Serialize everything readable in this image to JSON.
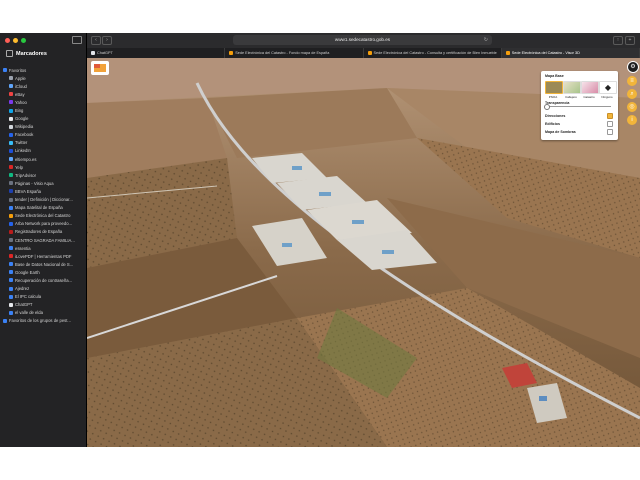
{
  "sidebar": {
    "title": "Marcadores",
    "items": [
      {
        "label": "Favoritos",
        "color": "#3b82f6",
        "type": "folder"
      },
      {
        "label": "Apple",
        "color": "#9ca3af"
      },
      {
        "label": "iCloud",
        "color": "#60a5fa"
      },
      {
        "label": "eBay",
        "color": "#ef4444"
      },
      {
        "label": "Yahoo",
        "color": "#7c3aed"
      },
      {
        "label": "Bing",
        "color": "#0ea5e9"
      },
      {
        "label": "Google",
        "color": "#e5e7eb"
      },
      {
        "label": "Wikipedia",
        "color": "#d1d5db"
      },
      {
        "label": "Facebook",
        "color": "#2563eb"
      },
      {
        "label": "Twitter",
        "color": "#38bdf8"
      },
      {
        "label": "LinkedIn",
        "color": "#1d4ed8"
      },
      {
        "label": "eltiempo.es",
        "color": "#60a5fa"
      },
      {
        "label": "Yelp",
        "color": "#dc2626"
      },
      {
        "label": "TripAdvisor",
        "color": "#10b981"
      },
      {
        "label": "Páginas - Visio Aqua",
        "color": "#6b7280"
      },
      {
        "label": "BBVA España",
        "color": "#1e40af"
      },
      {
        "label": "tender | Definición | Diccionar...",
        "color": "#6b7280"
      },
      {
        "label": "Mapa Satelital de España",
        "color": "#3b82f6"
      },
      {
        "label": "Sede Electrónica del Catastro",
        "color": "#f59e0b"
      },
      {
        "label": "Arba Network para proveedo...",
        "color": "#2563eb"
      },
      {
        "label": "Registradores de España",
        "color": "#b91c1c"
      },
      {
        "label": "CENTRO SAGRADA FAMILIA...",
        "color": "#6b7280"
      },
      {
        "label": "essentia",
        "color": "#3b82f6"
      },
      {
        "label": "iLovePDF | Herramientas PDF",
        "color": "#dc2626"
      },
      {
        "label": "Base de Datos Nacional de S...",
        "color": "#3b82f6"
      },
      {
        "label": "Google Earth",
        "color": "#3b82f6"
      },
      {
        "label": "Recuperación de contraseña...",
        "color": "#3b82f6"
      },
      {
        "label": "Ajedrez",
        "color": "#3b82f6"
      },
      {
        "label": "El IPC calcula",
        "color": "#3b82f6"
      },
      {
        "label": "ChatGPT",
        "color": "#e5e7eb"
      },
      {
        "label": "el valle de elda",
        "color": "#3b82f6"
      },
      {
        "label": "Favoritos de los grupos de pest...",
        "color": "#3b82f6",
        "type": "folder"
      }
    ]
  },
  "toolbar": {
    "url": "www1.sedecatastro.gob.es"
  },
  "tabs": [
    {
      "label": "ChatGPT",
      "color": "#e5e7eb"
    },
    {
      "label": "Sede Electrónica del Catastro - Fondo mapa de España",
      "color": "#f59e0b"
    },
    {
      "label": "Sede Electrónica del Catastro - Consulta y certificación de Bien Inmueble",
      "color": "#f59e0b"
    },
    {
      "label": "Sede Electrónica del Catastro - Visor 3D",
      "color": "#f59e0b"
    }
  ],
  "panel": {
    "title": "Mapa Base",
    "options": [
      "PNOA",
      "Callejero",
      "Catastro",
      "Ninguno"
    ],
    "transparency_label": "Transparencia",
    "layers": [
      {
        "label": "Direcciones",
        "checked": true
      },
      {
        "label": "Edificios",
        "checked": false
      },
      {
        "label": "Mapa de Sombras",
        "checked": false
      }
    ],
    "accent": "#f2b53a"
  }
}
